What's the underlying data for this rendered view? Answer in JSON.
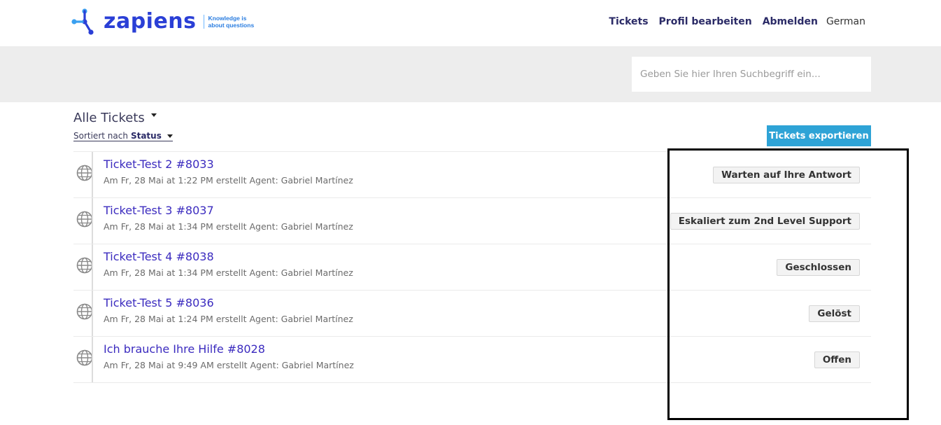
{
  "brand": {
    "name": "zapiens",
    "tagline_line1": "Knowledge is",
    "tagline_line2": "about questions",
    "color": "#2a3fd6"
  },
  "nav": {
    "tickets": "Tickets",
    "profile": "Profil bearbeiten",
    "logout": "Abmelden",
    "language": "German"
  },
  "search": {
    "placeholder": "Geben Sie hier Ihren Suchbegriff ein..."
  },
  "list": {
    "title": "Alle Tickets",
    "sort_prefix": "Sortiert nach",
    "sort_field": "Status",
    "export_label": "Tickets exportieren"
  },
  "tickets": [
    {
      "title": "Ticket-Test 2 #8033",
      "meta": "Am Fr, 28 Mai at 1:22 PM erstellt Agent: Gabriel Martínez",
      "status": "Warten auf Ihre Antwort"
    },
    {
      "title": "Ticket-Test 3 #8037",
      "meta": "Am Fr, 28 Mai at 1:34 PM erstellt Agent: Gabriel Martínez",
      "status": "Eskaliert zum 2nd Level Support"
    },
    {
      "title": "Ticket-Test 4 #8038",
      "meta": "Am Fr, 28 Mai at 1:34 PM erstellt Agent: Gabriel Martínez",
      "status": "Geschlossen"
    },
    {
      "title": "Ticket-Test 5 #8036",
      "meta": "Am Fr, 28 Mai at 1:24 PM erstellt Agent: Gabriel Martínez",
      "status": "Gelöst"
    },
    {
      "title": "Ich brauche Ihre Hilfe #8028",
      "meta": "Am Fr, 28 Mai at 9:49 AM erstellt Agent: Gabriel Martínez",
      "status": "Offen"
    }
  ],
  "colors": {
    "accent": "#2ea3d6",
    "link": "#3b2bbf",
    "nav": "#2b2b67",
    "band": "#ededed"
  }
}
